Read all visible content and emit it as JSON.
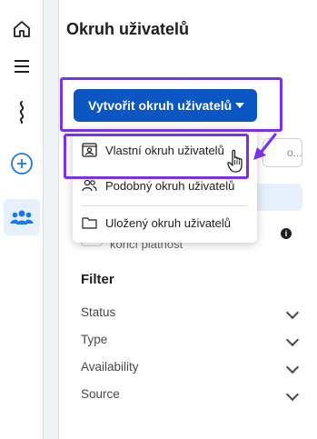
{
  "panel": {
    "title": "Okruh uživatelů"
  },
  "create_button": {
    "label": "Vytvořit okruh uživatelů"
  },
  "dropdown": {
    "items": [
      {
        "label": "Vlastní okruh uživatelů",
        "icon": "custom-audience-icon"
      },
      {
        "label": "Podobný okruh uživatelů",
        "icon": "lookalike-people-icon"
      },
      {
        "label": "Uložený okruh uživatelů",
        "icon": "folder-icon"
      }
    ]
  },
  "search": {
    "placeholder": "o..."
  },
  "behind_text": "končí platnost",
  "filter": {
    "title": "Filter",
    "items": [
      "Status",
      "Type",
      "Availability",
      "Source"
    ]
  },
  "colors": {
    "primary": "#0a56c2",
    "annotation": "#7b2ff0",
    "active_rail": "#1877f2"
  },
  "rail": {
    "icons": [
      "home-icon",
      "menu-icon",
      "squiggle-icon",
      "add-circle-icon",
      "audience-group-icon"
    ]
  }
}
